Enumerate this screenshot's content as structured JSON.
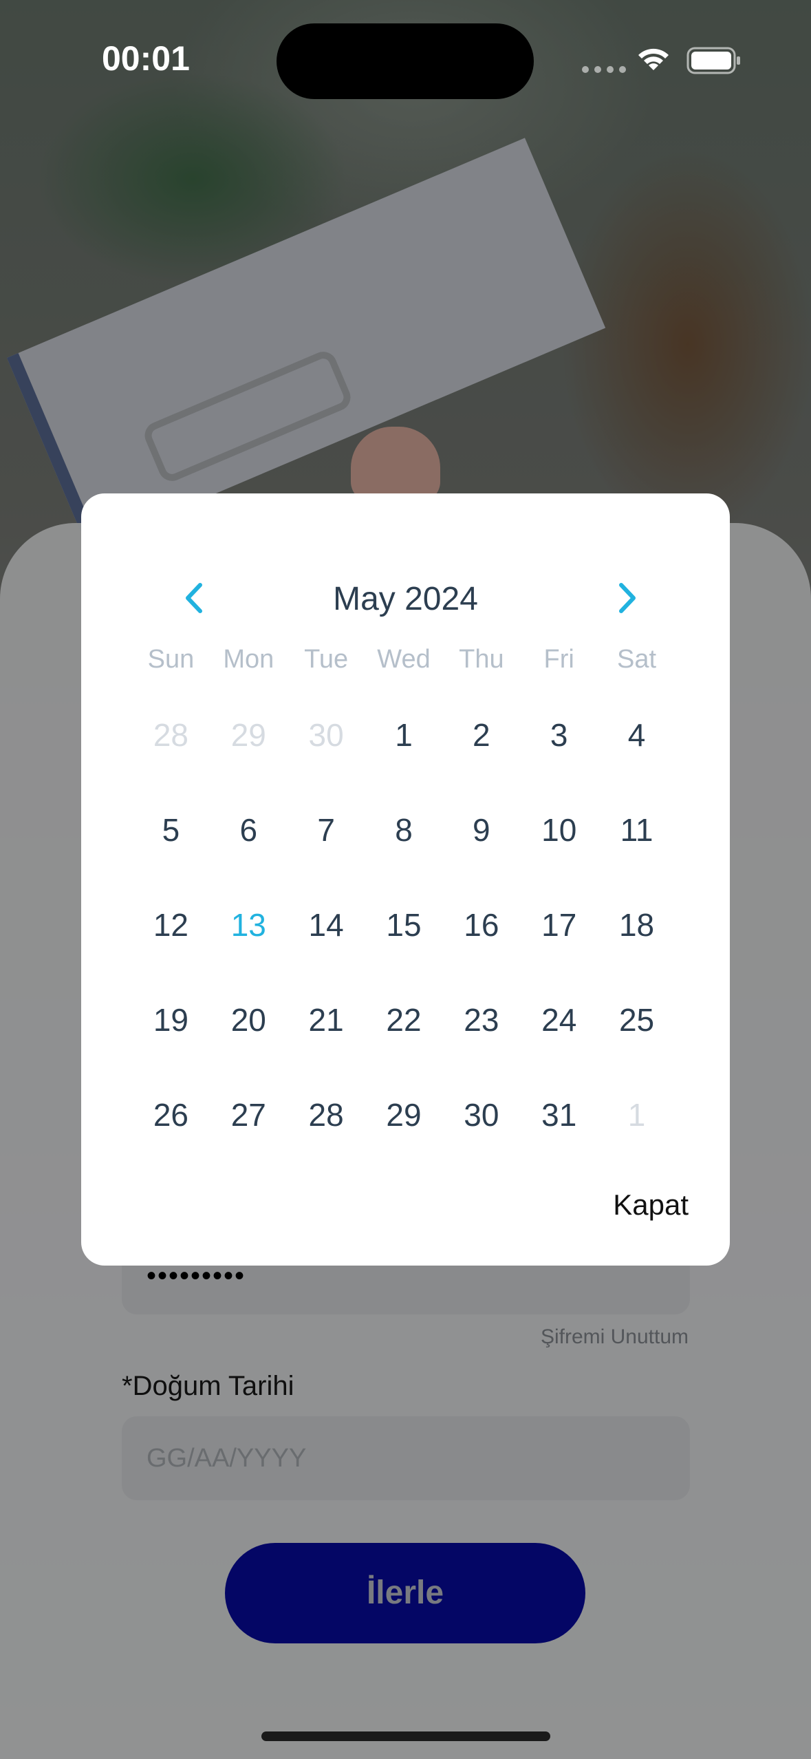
{
  "status_bar": {
    "time": "00:01"
  },
  "calendar": {
    "month_title": "May 2024",
    "weekdays": [
      "Sun",
      "Mon",
      "Tue",
      "Wed",
      "Thu",
      "Fri",
      "Sat"
    ],
    "days": [
      {
        "d": "28",
        "muted": true
      },
      {
        "d": "29",
        "muted": true
      },
      {
        "d": "30",
        "muted": true
      },
      {
        "d": "1"
      },
      {
        "d": "2"
      },
      {
        "d": "3"
      },
      {
        "d": "4"
      },
      {
        "d": "5"
      },
      {
        "d": "6"
      },
      {
        "d": "7"
      },
      {
        "d": "8"
      },
      {
        "d": "9"
      },
      {
        "d": "10"
      },
      {
        "d": "11"
      },
      {
        "d": "12"
      },
      {
        "d": "13",
        "today": true
      },
      {
        "d": "14"
      },
      {
        "d": "15"
      },
      {
        "d": "16"
      },
      {
        "d": "17"
      },
      {
        "d": "18"
      },
      {
        "d": "19"
      },
      {
        "d": "20"
      },
      {
        "d": "21"
      },
      {
        "d": "22"
      },
      {
        "d": "23"
      },
      {
        "d": "24"
      },
      {
        "d": "25"
      },
      {
        "d": "26"
      },
      {
        "d": "27"
      },
      {
        "d": "28"
      },
      {
        "d": "29"
      },
      {
        "d": "30"
      },
      {
        "d": "31"
      },
      {
        "d": "1",
        "muted": true
      }
    ],
    "close_label": "Kapat",
    "accent_color": "#21b2df"
  },
  "form": {
    "password_value": "•••••••••",
    "forgot_password": "Şifremi Unuttum",
    "dob_label": "*Doğum Tarihi",
    "dob_placeholder": "GG/AA/YYYY",
    "next_button": "İlerle",
    "button_color": "#070aa8"
  }
}
